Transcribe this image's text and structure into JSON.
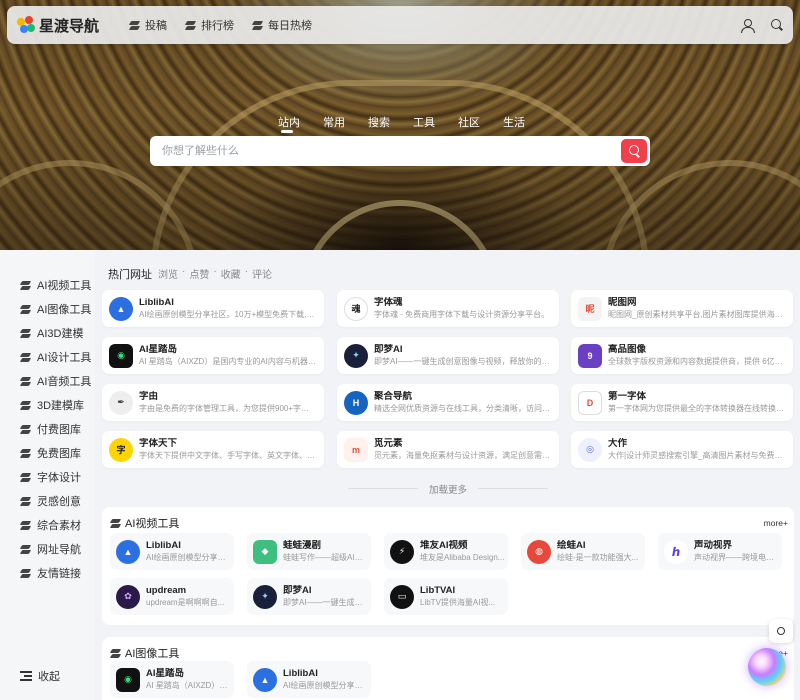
{
  "header": {
    "logo_text": "星渡导航",
    "nav": [
      {
        "label": "投稿",
        "icon": "layers-icon"
      },
      {
        "label": "排行榜",
        "icon": "layers-icon"
      },
      {
        "label": "每日热榜",
        "icon": "layers-icon"
      }
    ],
    "right_icons": [
      "user-icon",
      "search-icon"
    ]
  },
  "search": {
    "tabs": [
      "站内",
      "常用",
      "搜索",
      "工具",
      "社区",
      "生活"
    ],
    "active_tab": "站内",
    "placeholder": "你想了解些什么",
    "accent_color": "#f1404b"
  },
  "sidebar": {
    "items": [
      "AI视频工具",
      "AI图像工具",
      "AI3D建模",
      "AI设计工具",
      "AI音频工具",
      "3D建模库",
      "付费图库",
      "免费图库",
      "字体设计",
      "灵感创意",
      "综合素材",
      "网址导航",
      "友情链接"
    ],
    "collapse_label": "收起"
  },
  "hot": {
    "title": "热门网址",
    "filters": [
      "浏览",
      "点赞",
      "收藏",
      "评论"
    ],
    "cards": [
      {
        "title": "LiblibAI",
        "desc": "AI绘画原创模型分享社区。10万+模型免费下载,需计...",
        "icon": "liblib-logo"
      },
      {
        "title": "字体魂",
        "desc": "字体魂 - 免费商用字体下载与设计资源分享平台。",
        "icon": "ziti-hun-logo"
      },
      {
        "title": "昵图网",
        "desc": "昵图网_原创素材共享平台,图片素材图库提供海量原...",
        "icon": "nipic-logo"
      },
      {
        "title": "AI星踏岛",
        "desc": "AI 星踏岛（AIXZD）是国内专业的AI内容与机器人产...",
        "icon": "aixzd-logo"
      },
      {
        "title": "即梦AI",
        "desc": "即梦AI——一键生成创意图像与视频，释放你的无限...",
        "icon": "jimeng-logo"
      },
      {
        "title": "高品图像",
        "desc": "全球数字版权资源和内容数据提供商，提供 6亿高品...",
        "icon": "gaopin-logo"
      },
      {
        "title": "字由",
        "desc": "字由是免费的字体管理工具，为您提供900+字体免...",
        "icon": "ziyou-logo"
      },
      {
        "title": "聚合导航",
        "desc": "精选全网优质资源与在线工具，分类清晰，访问便捷...",
        "icon": "juhe-logo"
      },
      {
        "title": "第一字体",
        "desc": "第一字体网为您提供最全的字体转换器在线转换、艺...",
        "icon": "diyi-ziti-logo"
      },
      {
        "title": "字体天下",
        "desc": "字体天下提供中文字体、手写字体、英文字体、图形...",
        "icon": "ziti-tianxia-logo"
      },
      {
        "title": "觅元素",
        "desc": "觅元素，海量免抠素材与设计资源，满足创意需求的...",
        "icon": "miyuansu-logo"
      },
      {
        "title": "大作",
        "desc": "大作|设计师灵感搜索引擎_高清图片素材与免费版权...",
        "icon": "dazuo-logo"
      }
    ],
    "load_more": "加载更多"
  },
  "sections": [
    {
      "title": "AI视频工具",
      "more": "more+",
      "tools": [
        {
          "title": "LiblibAI",
          "desc": "AI绘画原创模型分享社...",
          "icon": "liblib-logo"
        },
        {
          "title": "蛙蛙漫剧",
          "desc": "蛙蛙写作——超级AI智...",
          "icon": "wawa-logo"
        },
        {
          "title": "堆友AI视频",
          "desc": "堆友是Alibaba Design...",
          "icon": "duiyou-logo"
        },
        {
          "title": "绘蛙AI",
          "desc": "绘蛙-是一款功能强大...",
          "icon": "huiwa-logo"
        },
        {
          "title": "声动视界",
          "desc": "声动视界——跨境电商...",
          "icon": "shengdong-logo"
        },
        {
          "title": "updream",
          "desc": "updream是啊啊啊自...",
          "icon": "updream-logo"
        },
        {
          "title": "即梦AI",
          "desc": "即梦AI——一键生成创...",
          "icon": "jimeng-logo"
        },
        {
          "title": "LibTVAI",
          "desc": "LibTV提供海量AI视...",
          "icon": "libtv-logo"
        }
      ]
    },
    {
      "title": "AI图像工具",
      "more": "more+",
      "tools": [
        {
          "title": "AI星踏岛",
          "desc": "AI 星踏岛（AIXZD）是...",
          "icon": "aixzd-logo"
        },
        {
          "title": "LiblibAI",
          "desc": "AI绘画原创模型分享社...",
          "icon": "liblib-logo"
        }
      ]
    }
  ]
}
